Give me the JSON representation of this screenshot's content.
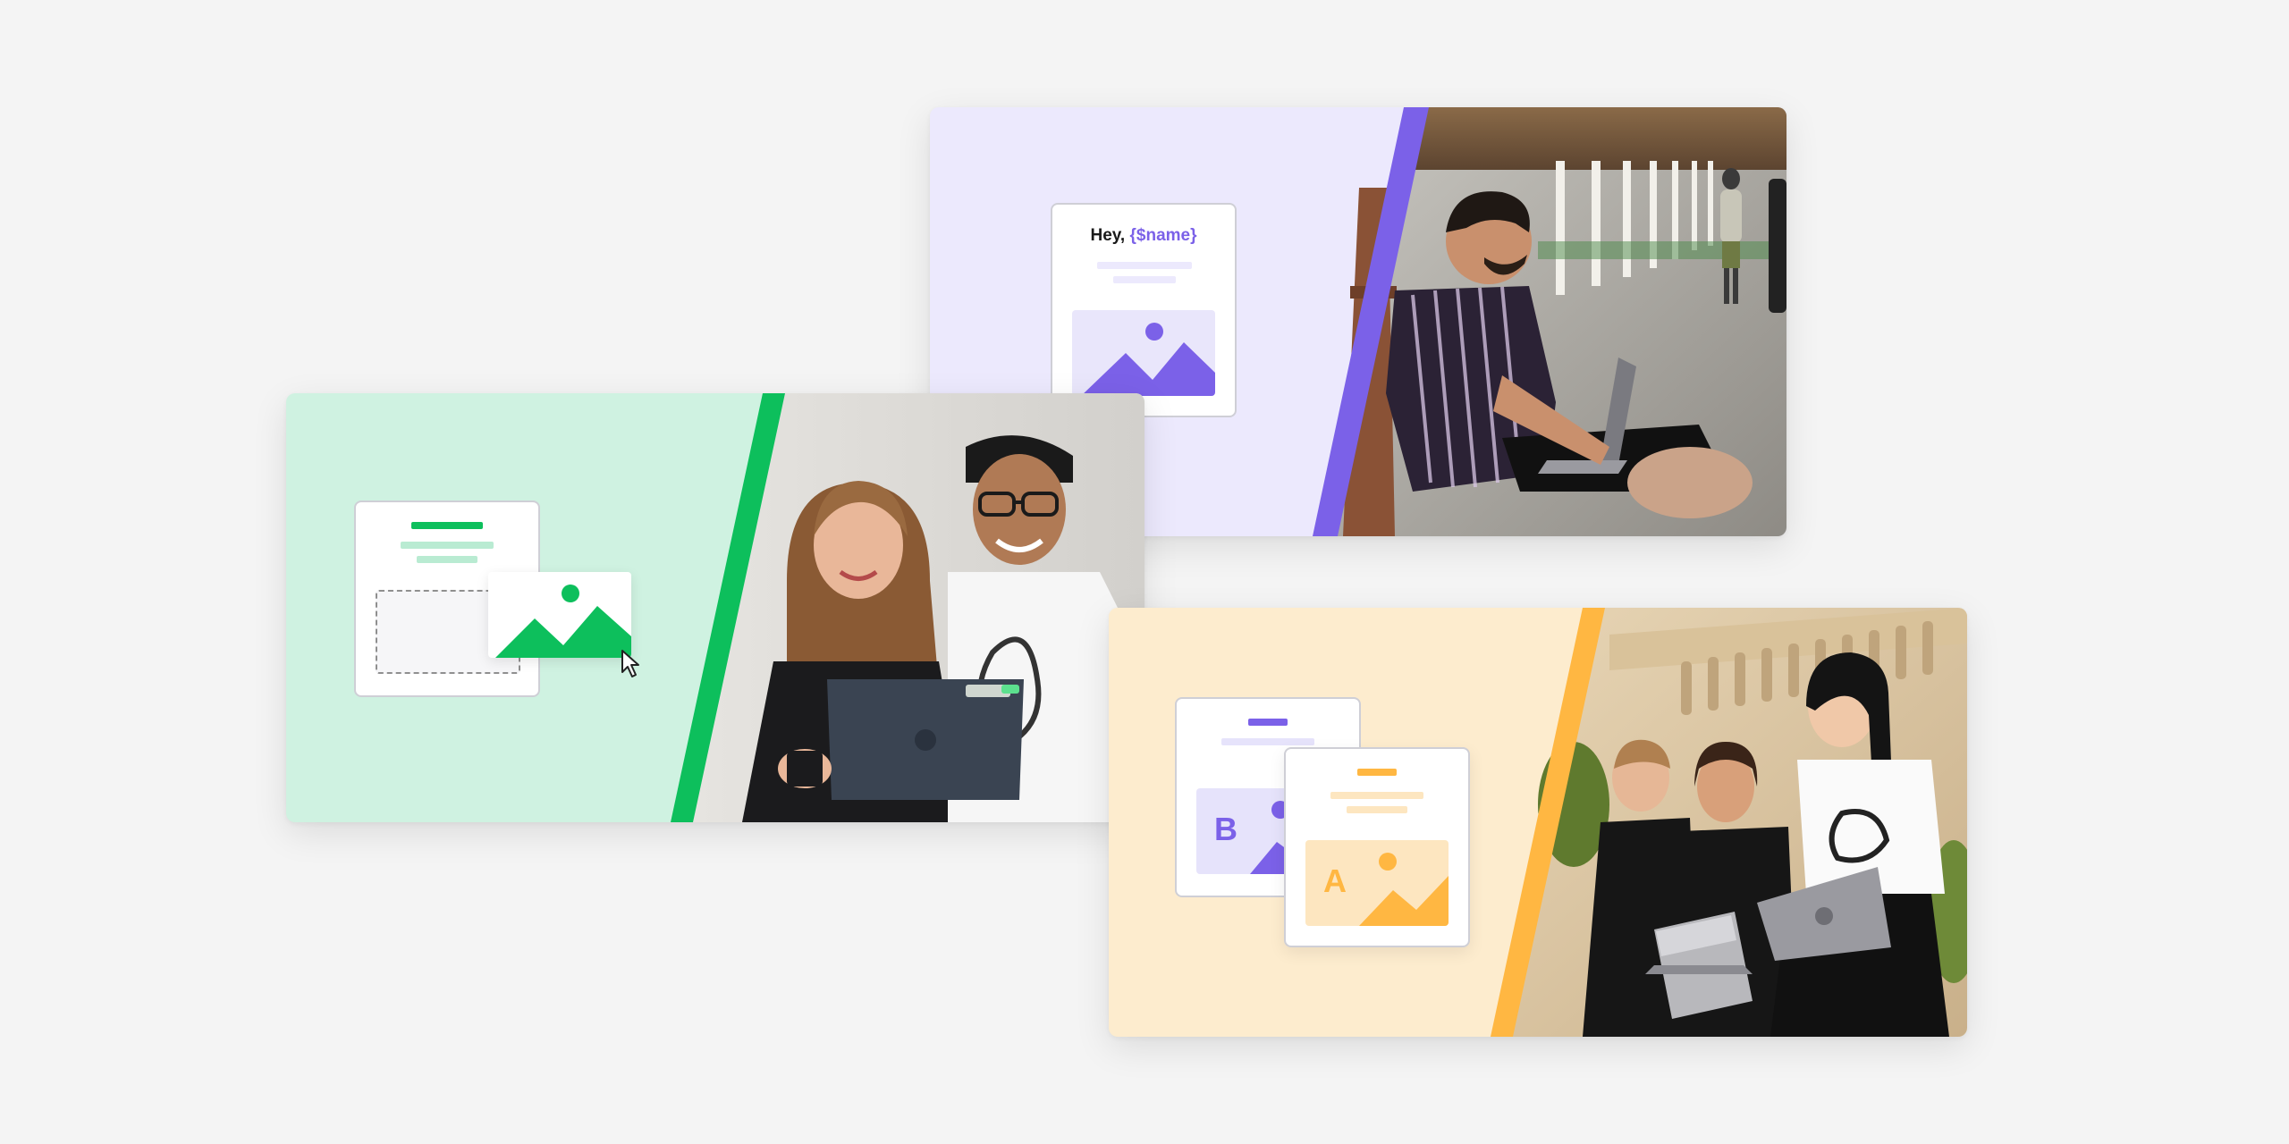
{
  "colors": {
    "page_background": "#f4f4f4",
    "purple_accent": "#7b61e8",
    "purple_light": "#ece9fd",
    "green_accent": "#0dbf5c",
    "green_light": "#cff2e1",
    "yellow_accent": "#ffb742",
    "yellow_light": "#fdecce"
  },
  "personalization_card": {
    "greeting_prefix": "Hey, ",
    "greeting_variable": "{$name}",
    "photo": "man-with-laptop-photo"
  },
  "drag_drop_card": {
    "photo": "two-people-with-laptop-photo",
    "cursor": "arrow-cursor-icon"
  },
  "ab_test_card": {
    "variant_b_letter": "B",
    "variant_a_letter": "A",
    "photo": "three-people-with-laptops-photo"
  }
}
